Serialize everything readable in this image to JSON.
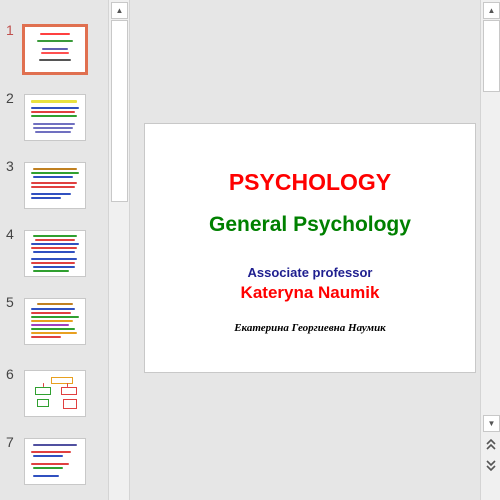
{
  "thumbnails": [
    {
      "number": "1",
      "active": true
    },
    {
      "number": "2",
      "active": false
    },
    {
      "number": "3",
      "active": false
    },
    {
      "number": "4",
      "active": false
    },
    {
      "number": "5",
      "active": false
    },
    {
      "number": "6",
      "active": false
    },
    {
      "number": "7",
      "active": false
    }
  ],
  "slide": {
    "title": "PSYCHOLOGY",
    "subtitle": "General Psychology",
    "role": "Associate professor",
    "author": "Kateryna Naumik",
    "author_native": "Екатерина Георгиевна Наумик"
  },
  "colors": {
    "title": "#ff0000",
    "subtitle": "#008000",
    "role": "#1f1f8f",
    "author": "#ff0000",
    "active_border": "#e07050"
  },
  "icons": {
    "scroll_up": "triangle-up-icon",
    "scroll_down": "triangle-down-icon",
    "prev_slide": "double-chevron-up-icon",
    "next_slide": "double-chevron-down-icon"
  }
}
